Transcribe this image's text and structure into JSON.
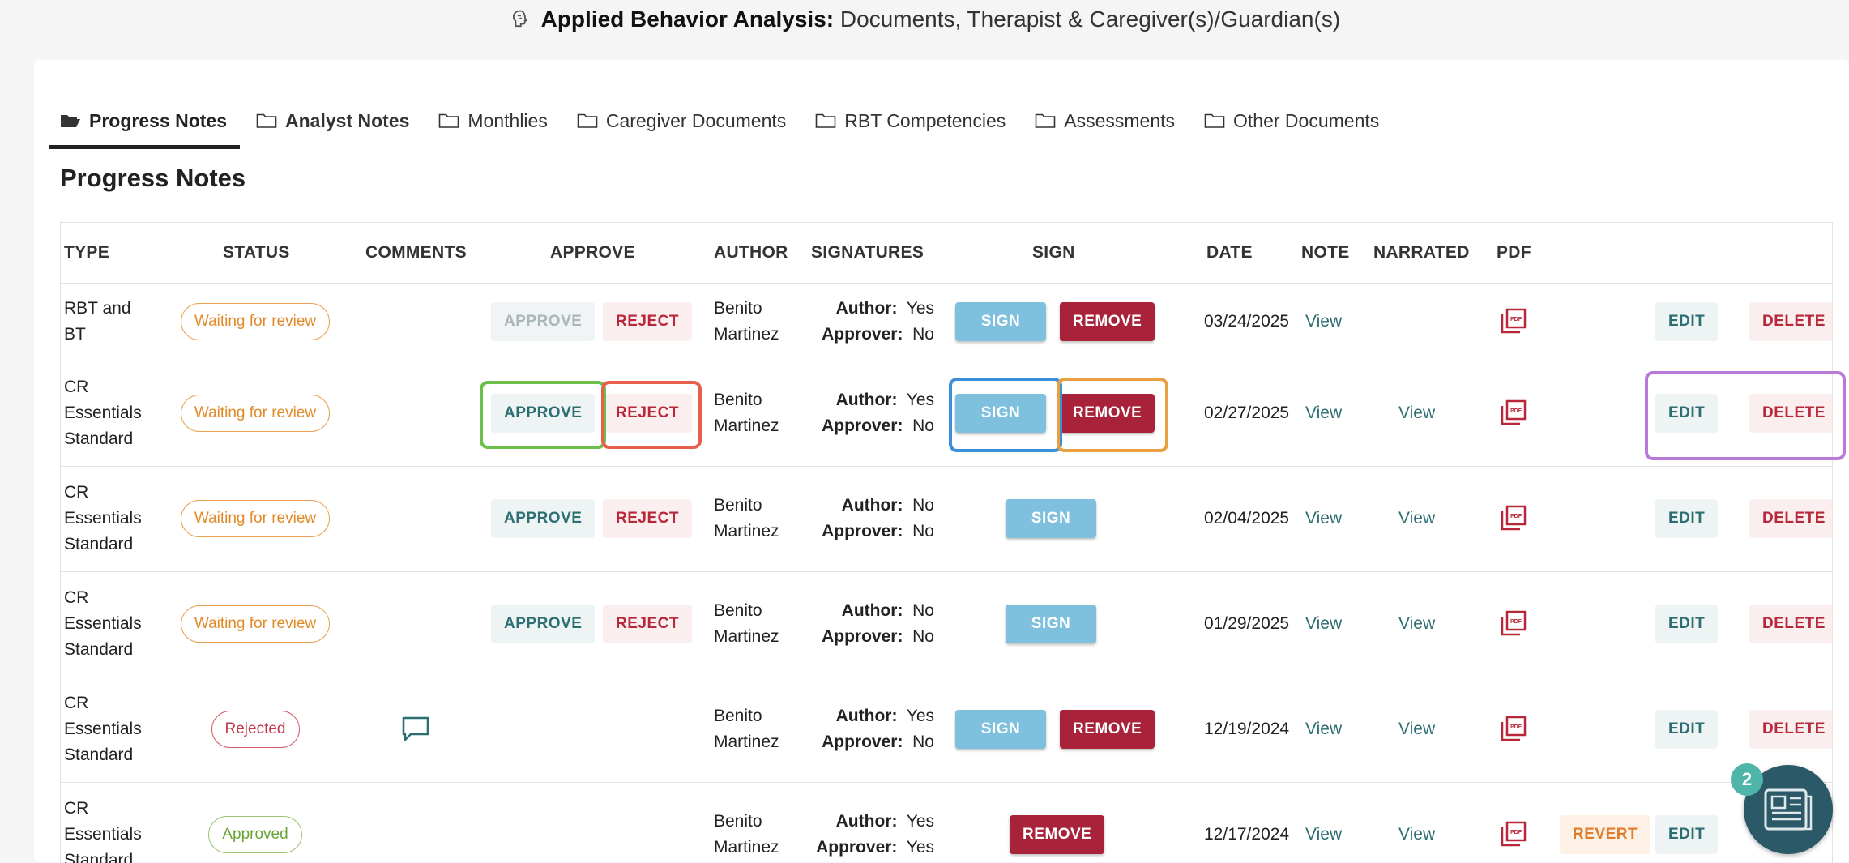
{
  "header": {
    "title_bold": "Applied Behavior Analysis:",
    "title_rest": " Documents, Therapist & Caregiver(s)/Guardian(s)"
  },
  "tabs": [
    {
      "label": "Progress Notes"
    },
    {
      "label": "Analyst Notes"
    },
    {
      "label": "Monthlies"
    },
    {
      "label": "Caregiver Documents"
    },
    {
      "label": "RBT Competencies"
    },
    {
      "label": "Assessments"
    },
    {
      "label": "Other Documents"
    }
  ],
  "section_title": "Progress Notes",
  "columns": {
    "type": "TYPE",
    "status": "STATUS",
    "comments": "COMMENTS",
    "approve": "APPROVE",
    "author": "AUTHOR",
    "signatures": "SIGNATURES",
    "sign": "SIGN",
    "date": "DATE",
    "note": "NOTE",
    "narrated": "NARRATED",
    "pdf": "PDF"
  },
  "labels": {
    "approve": "APPROVE",
    "reject": "REJECT",
    "sign": "SIGN",
    "remove": "REMOVE",
    "edit": "EDIT",
    "delete": "DELETE",
    "revert": "REVERT",
    "view": "View",
    "author_sig": "Author:",
    "approver_sig": "Approver:"
  },
  "rows": [
    {
      "type_l1": "RBT and",
      "type_l2": "BT",
      "type_l3": "",
      "status": "Waiting for review",
      "author_l1": "Benito",
      "author_l2": "Martinez",
      "author_sig": "Yes",
      "approver_sig": "No",
      "date": "03/24/2025",
      "note": "View",
      "narrated": ""
    },
    {
      "type_l1": "CR",
      "type_l2": "Essentials",
      "type_l3": "Standard",
      "status": "Waiting for review",
      "author_l1": "Benito",
      "author_l2": "Martinez",
      "author_sig": "Yes",
      "approver_sig": "No",
      "date": "02/27/2025",
      "note": "View",
      "narrated": "View"
    },
    {
      "type_l1": "CR",
      "type_l2": "Essentials",
      "type_l3": "Standard",
      "status": "Waiting for review",
      "author_l1": "Benito",
      "author_l2": "Martinez",
      "author_sig": "No",
      "approver_sig": "No",
      "date": "02/04/2025",
      "note": "View",
      "narrated": "View"
    },
    {
      "type_l1": "CR",
      "type_l2": "Essentials",
      "type_l3": "Standard",
      "status": "Waiting for review",
      "author_l1": "Benito",
      "author_l2": "Martinez",
      "author_sig": "No",
      "approver_sig": "No",
      "date": "01/29/2025",
      "note": "View",
      "narrated": "View"
    },
    {
      "type_l1": "CR",
      "type_l2": "Essentials",
      "type_l3": "Standard",
      "status": "Rejected",
      "author_l1": "Benito",
      "author_l2": "Martinez",
      "author_sig": "Yes",
      "approver_sig": "No",
      "date": "12/19/2024",
      "note": "View",
      "narrated": "View"
    },
    {
      "type_l1": "CR",
      "type_l2": "Essentials",
      "type_l3": "Standard",
      "status": "Approved",
      "author_l1": "Benito",
      "author_l2": "Martinez",
      "author_sig": "Yes",
      "approver_sig": "Yes",
      "date": "12/17/2024",
      "note": "View",
      "narrated": "View"
    }
  ],
  "notification_count": "2",
  "colors": {
    "sign": "#7ec0de",
    "remove": "#a8233a",
    "highlight_approve": "#6cc04a",
    "highlight_reject": "#e8604c",
    "highlight_sign": "#3b8fdb",
    "highlight_remove": "#e9a040",
    "highlight_edit_delete": "#b77ad8"
  }
}
